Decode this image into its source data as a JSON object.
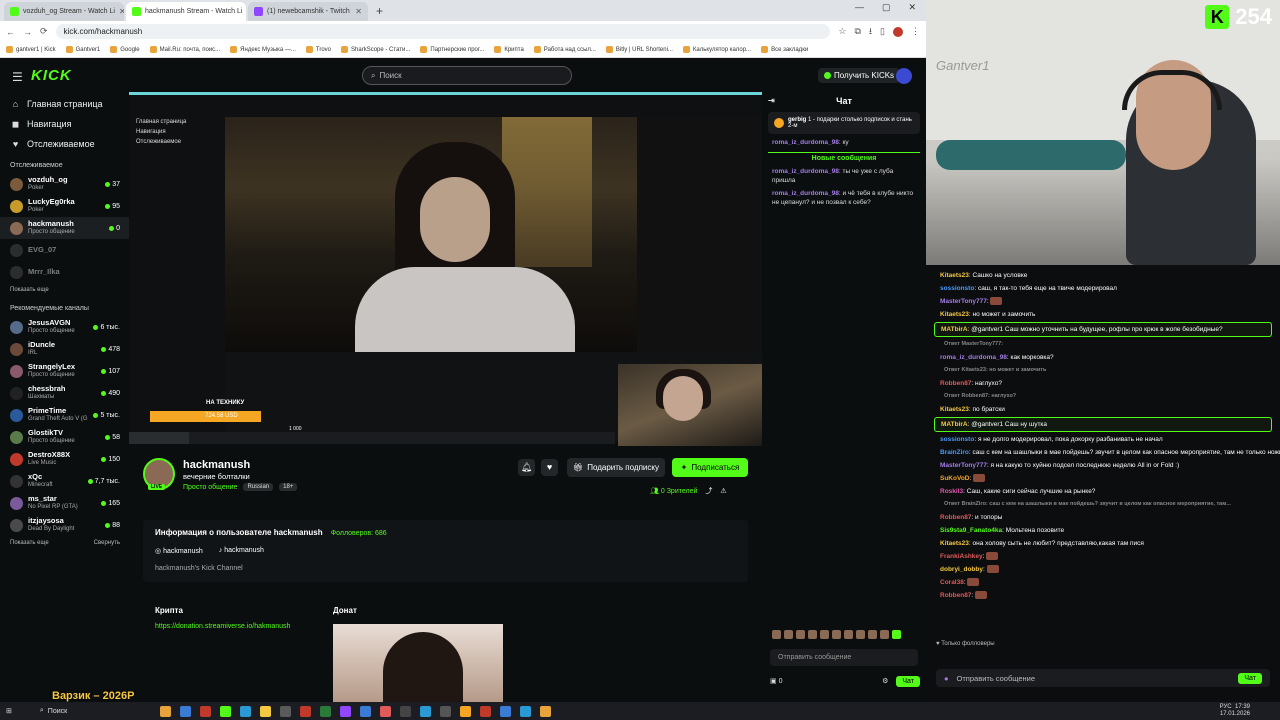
{
  "browser": {
    "tabs": [
      {
        "title": "vozduh_og Stream - Watch Li",
        "color": "#53fc18"
      },
      {
        "title": "hackmanush Stream - Watch Li",
        "color": "#53fc18"
      },
      {
        "title": "(1) newebcamshik - Twitch",
        "color": "#9146ff"
      }
    ],
    "new_tab": "+",
    "url": "kick.com/hackmanush",
    "bookmarks": [
      "gantver1 | Kick",
      "Gantver1",
      "Google",
      "Mail.Ru: почта, поис...",
      "Яндекс Музыка —...",
      "Trovo",
      "SharkScope - Стати...",
      "Партнерские прог...",
      "Крипта",
      "Работа над ссыл...",
      "Bitly | URL Shorteni...",
      "Калькулятор калор...",
      "Все закладки"
    ]
  },
  "kick": {
    "logo": "KICK",
    "search_placeholder": "Поиск",
    "get_kicks": "Получить KICKs",
    "nav": [
      {
        "label": "Главная страница",
        "icon": "home-icon",
        "glyph": "⌂"
      },
      {
        "label": "Навигация",
        "icon": "compass-icon",
        "glyph": "◼"
      },
      {
        "label": "Отслеживаемое",
        "icon": "heart-icon",
        "glyph": "♥"
      }
    ],
    "following_title": "Отслеживаемое",
    "following": [
      {
        "name": "vozduh_og",
        "game": "Poker",
        "count": "37",
        "color": "#7c5a3c"
      },
      {
        "name": "LuckyEg0rka",
        "game": "Poker",
        "count": "95",
        "color": "#c79b2a"
      },
      {
        "name": "hackmanush",
        "game": "Просто общение",
        "count": "0",
        "color": "#8a6a55"
      },
      {
        "name": "EVG_07",
        "game": "",
        "count": "",
        "color": "#555"
      },
      {
        "name": "Mrrr_Ilka",
        "game": "",
        "count": "",
        "color": "#555"
      }
    ],
    "show_more": "Показать еще",
    "recommended_title": "Рекомендуемые каналы",
    "recommended": [
      {
        "name": "JesusAVGN",
        "game": "Просто общение",
        "count": "6 тыс.",
        "color": "#556b8a"
      },
      {
        "name": "iDuncle",
        "game": "IRL",
        "count": "478",
        "color": "#6b4a3a"
      },
      {
        "name": "StrangelyLex",
        "game": "Просто общение",
        "count": "107",
        "color": "#8a5a6a"
      },
      {
        "name": "chessbrah",
        "game": "Шахматы",
        "count": "490",
        "color": "#222"
      },
      {
        "name": "PrimeTime",
        "game": "Grand Theft Auto V (G...",
        "count": "5 тыс.",
        "color": "#2a5a9a"
      },
      {
        "name": "GlostikTV",
        "game": "Просто общение",
        "count": "58",
        "color": "#5a7a4a"
      },
      {
        "name": "DestroX88X",
        "game": "Live Music",
        "count": "150",
        "color": "#c0392b"
      },
      {
        "name": "xQc",
        "game": "Minecraft",
        "count": "7,7 тыс.",
        "color": "#333"
      },
      {
        "name": "ms_star",
        "game": "No Pixel RP (GTA)",
        "count": "165",
        "color": "#7a5a9a"
      },
      {
        "name": "itzjaysosa",
        "game": "Dead By Daylight",
        "count": "88",
        "color": "#4a4a4a"
      }
    ],
    "show_more2": "Показать еще",
    "collapse": "Свернуть",
    "inner": {
      "nav": [
        "Главная страница",
        "Навигация",
        "Отслеживаемое"
      ],
      "overlay_text": "НА ТЕХНИКУ",
      "amount": "724.58 USD",
      "goal": "1 000"
    },
    "channel": {
      "name": "hackmanush",
      "title": "вечерние болталки",
      "category": "Просто общение",
      "tags": [
        "Russian",
        "18+"
      ],
      "live": "LIVE",
      "gift": "Подарить подписку",
      "subscribe": "Подписаться",
      "viewers": "0",
      "viewers_label": "Зрителей"
    },
    "about": {
      "title": "Информация о пользователе hackmanush",
      "followers_label": "Фолловеров:",
      "followers": "686",
      "instagram": "hackmanush",
      "tiktok": "hackmanush",
      "description": "hackmanush's Kick Channel"
    },
    "panels": {
      "crypto_title": "Крипта",
      "crypto_link": "https://donation.streamiverse.io/hakmanush",
      "donate_title": "Донат"
    },
    "chat": {
      "title": "Чат",
      "pinned_user": "gerbig",
      "pinned_text": "1 - подарки столько подписок и стань 2-м",
      "messages_before": [
        {
          "user": "roma_iz_durdoma_98",
          "text": "ку"
        }
      ],
      "new_messages": "Новые сообщения",
      "messages": [
        {
          "user": "roma_iz_durdoma_98",
          "text": "ты че уже с луба пришла"
        },
        {
          "user": "roma_iz_durdoma_98",
          "text": "и чё тебя в клубе никто не цепанул? и не позвал к себе?"
        }
      ],
      "input_placeholder": "Отправить сообщение",
      "kicks": "0",
      "send": "Чат"
    }
  },
  "overlay": {
    "kick_count": "254",
    "webcam_watermark": "Gantver1",
    "messages": [
      {
        "user": "Kitaets23",
        "color": "#f5c842",
        "text": "Сашко на условке",
        "type": "normal"
      },
      {
        "user": "sossionsto",
        "color": "#4a9af5",
        "text": "саш, я так-то тебя еще на твиче модерировал",
        "type": "normal"
      },
      {
        "user": "MasterTony777",
        "color": "#a57ee9",
        "text": "",
        "type": "emote"
      },
      {
        "user": "Kitaets23",
        "color": "#f5c842",
        "text": "но может и замочить",
        "type": "normal"
      },
      {
        "user": "MATbirA",
        "color": "#f5c842",
        "text": "@gantver1 Саш можно уточнить на будущее, рофлы про крюк в жопе безобидные?",
        "type": "highlight"
      },
      {
        "user": "Ответ MasterTony777:",
        "color": "#888",
        "text": "",
        "type": "reply"
      },
      {
        "user": "roma_iz_durdoma_98",
        "color": "#a57ee9",
        "text": "как морковка?",
        "type": "normal"
      },
      {
        "user": "Ответ Kitaets23: но может и замочить",
        "color": "#888",
        "text": "",
        "type": "reply"
      },
      {
        "user": "Robben87",
        "color": "#e05a5a",
        "text": "наглухо?",
        "type": "normal"
      },
      {
        "user": "Ответ Robben87: наглухо?",
        "color": "#888",
        "text": "",
        "type": "reply"
      },
      {
        "user": "Kitaets23",
        "color": "#f5c842",
        "text": "по братски",
        "type": "normal"
      },
      {
        "user": "MATbirA",
        "color": "#f5c842",
        "text": "@gantver1 Саш ну шутка",
        "type": "highlight"
      },
      {
        "user": "sossionsto",
        "color": "#4a9af5",
        "text": "я не долго модерировал, пока докорку разбанивать не начал",
        "type": "normal"
      },
      {
        "user": "BrainZiro",
        "color": "#4a9af5",
        "text": "саш с кем на шашлыки в мае пойдешь? звучит в целом как опасное мероприятие, там не только ножи но и шампуры же будут",
        "type": "normal"
      },
      {
        "user": "MasterTony777",
        "color": "#a57ee9",
        "text": "я на какую то хуйню подсел последнюю неделю All in or Fold :)",
        "type": "normal"
      },
      {
        "user": "SuKoVoD",
        "color": "#f5a623",
        "text": "",
        "type": "emote"
      },
      {
        "user": "RoskiI3",
        "color": "#e05ab0",
        "text": "Саш, какие сиги сейчас лучшие на рынке?",
        "type": "normal"
      },
      {
        "user": "Ответ BrainZiro: саш с кем на шашлыки в мае пойдешь? звучит в целом как опасное мероприятие, там...",
        "color": "#888",
        "text": "",
        "type": "reply"
      },
      {
        "user": "Robben87",
        "color": "#e05a5a",
        "text": "и топоры",
        "type": "normal"
      },
      {
        "user": "Sis9sta9_Fanato4ka",
        "color": "#53fc18",
        "text": "Мольтена позовите",
        "type": "normal"
      },
      {
        "user": "Kitaets23",
        "color": "#f5c842",
        "text": "она холову сыть не любит? представляю,какая там пися",
        "type": "normal"
      },
      {
        "user": "FrankiAshkey",
        "color": "#e05a5a",
        "text": "",
        "type": "emote"
      },
      {
        "user": "dobryi_dobby",
        "color": "#f5c842",
        "text": "",
        "type": "emote"
      },
      {
        "user": "Coral38",
        "color": "#e05a5a",
        "text": "",
        "type": "emote"
      },
      {
        "user": "Robben87",
        "color": "#e05a5a",
        "text": "",
        "type": "emote"
      }
    ],
    "only_followers": "Только фолловеры",
    "input_placeholder": "Отправить сообщение",
    "send": "Чат"
  },
  "taskbar": {
    "promo": "Варзик – 2026Р",
    "search": "Поиск",
    "lang": "РУС",
    "time": "17:39",
    "date": "17.01.2026"
  }
}
